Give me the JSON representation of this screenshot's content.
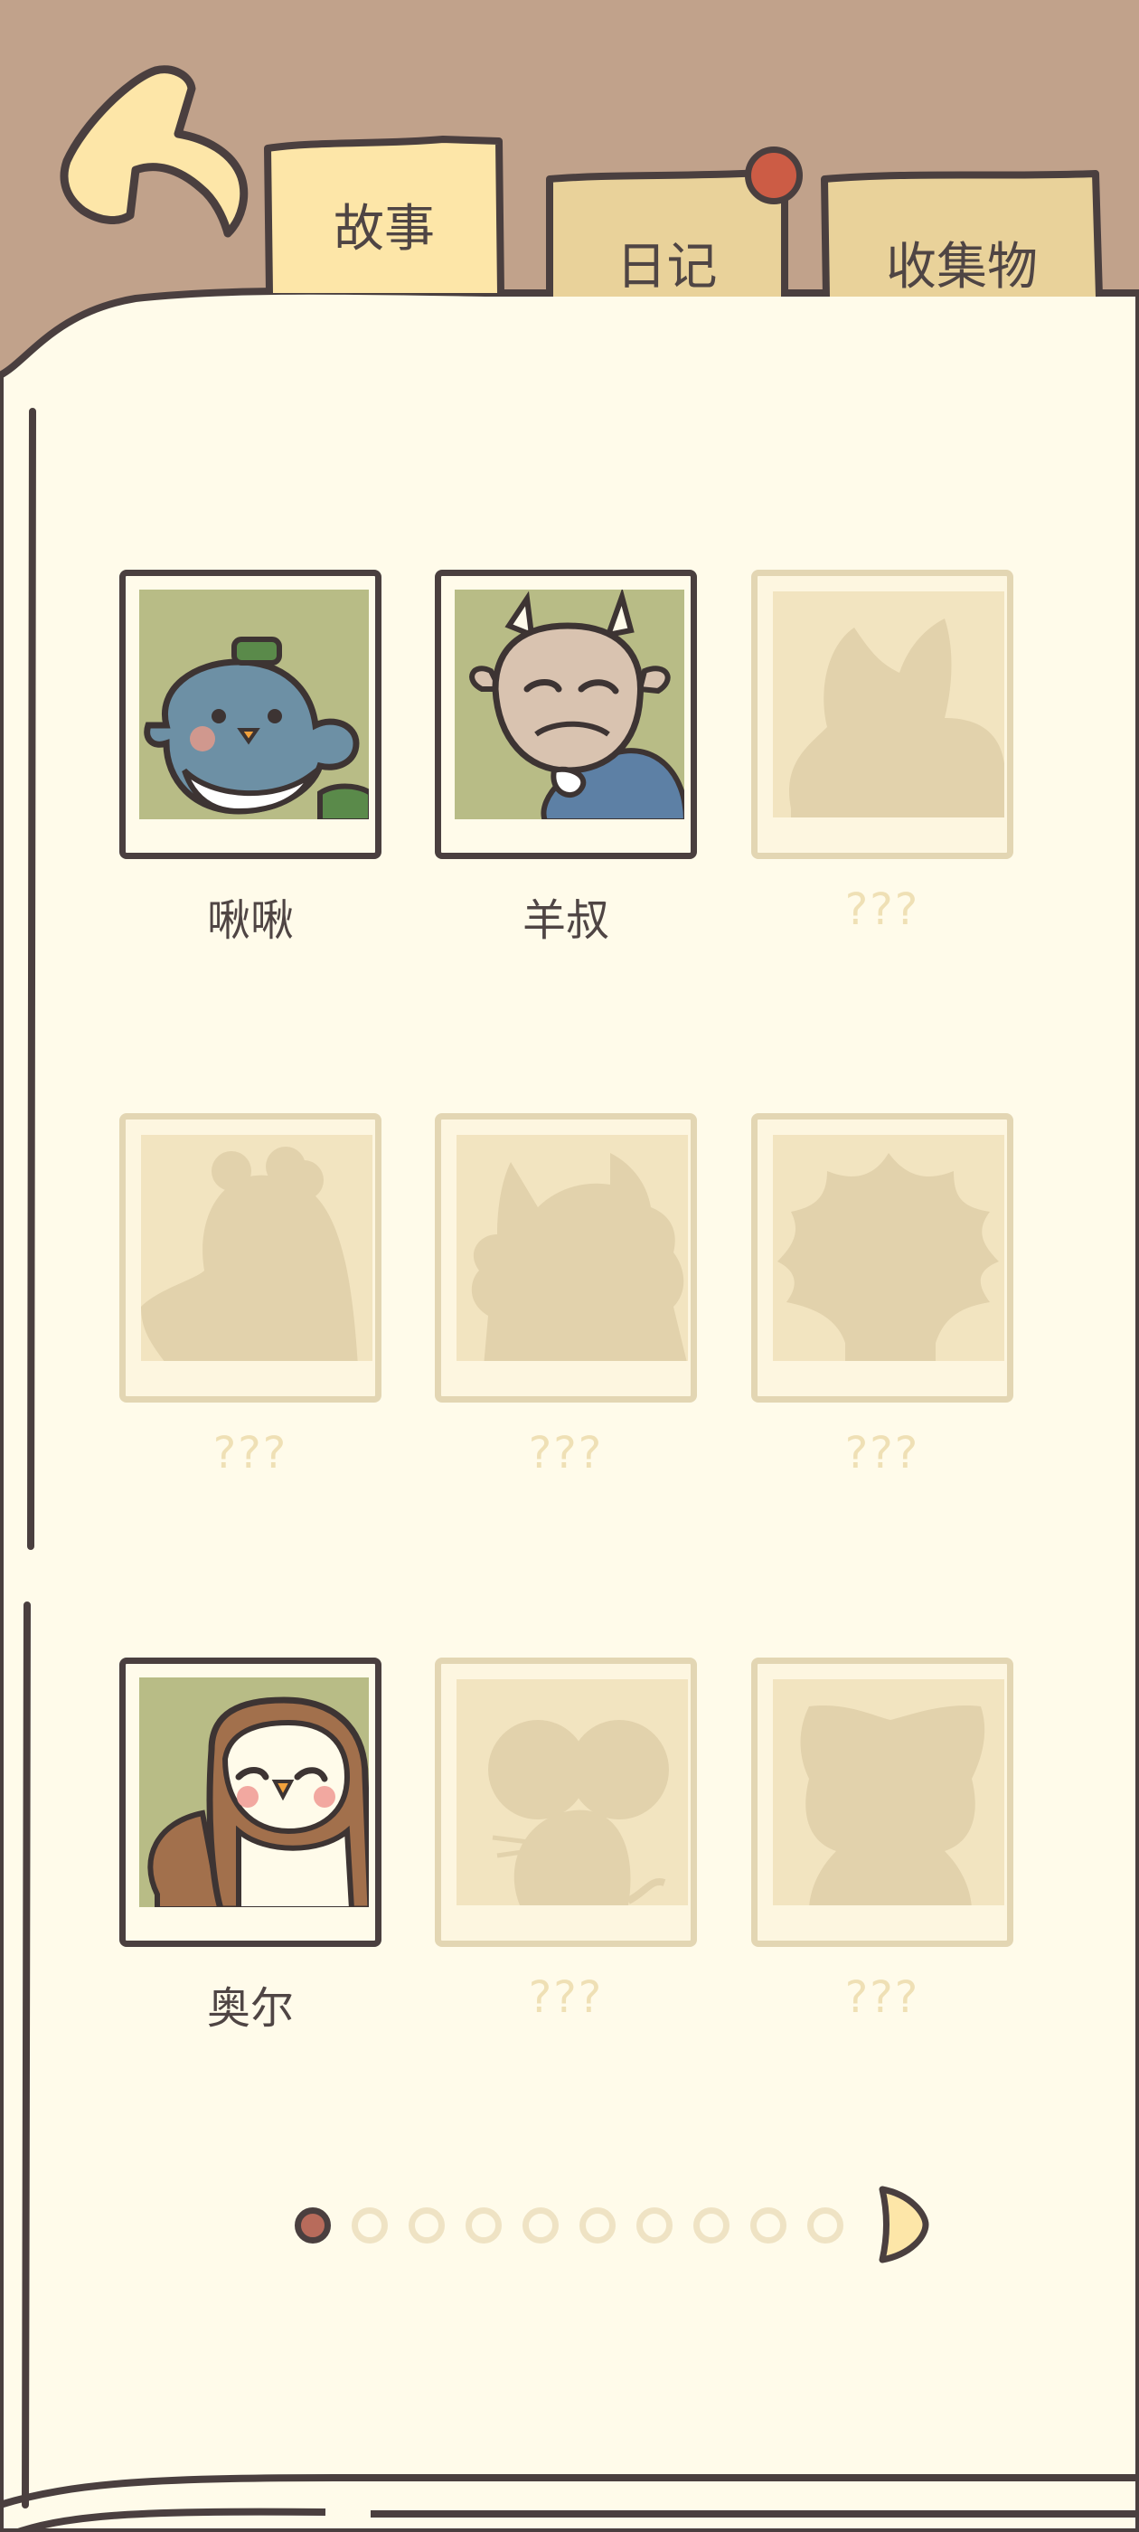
{
  "tabs": [
    {
      "label": "故事",
      "active": true
    },
    {
      "label": "日记",
      "active": false,
      "badge": true
    },
    {
      "label": "收集物",
      "active": false
    }
  ],
  "characters": [
    {
      "name": "啾啾",
      "unlocked": true,
      "silhouette": "bird"
    },
    {
      "name": "羊叔",
      "unlocked": true,
      "silhouette": "goat"
    },
    {
      "name": "???",
      "unlocked": false,
      "silhouette": "fox"
    },
    {
      "name": "???",
      "unlocked": false,
      "silhouette": "bear"
    },
    {
      "name": "???",
      "unlocked": false,
      "silhouette": "cat"
    },
    {
      "name": "???",
      "unlocked": false,
      "silhouette": "hedgehog"
    },
    {
      "name": "奥尔",
      "unlocked": true,
      "silhouette": "owl"
    },
    {
      "name": "???",
      "unlocked": false,
      "silhouette": "mouse"
    },
    {
      "name": "???",
      "unlocked": false,
      "silhouette": "kitten"
    }
  ],
  "pagination": {
    "total_pages": 10,
    "current_page": 1
  },
  "colors": {
    "background_top": "#c1a28b",
    "page": "#fffbea",
    "outline": "#4a3f3f",
    "tab_active": "#fde6a8",
    "tab_inactive": "#e9d29a",
    "badge": "#cc5c45",
    "photo_bg": "#b8bc86",
    "locked_border": "#e3d6b3",
    "locked_fill": "#e2d2ac"
  }
}
